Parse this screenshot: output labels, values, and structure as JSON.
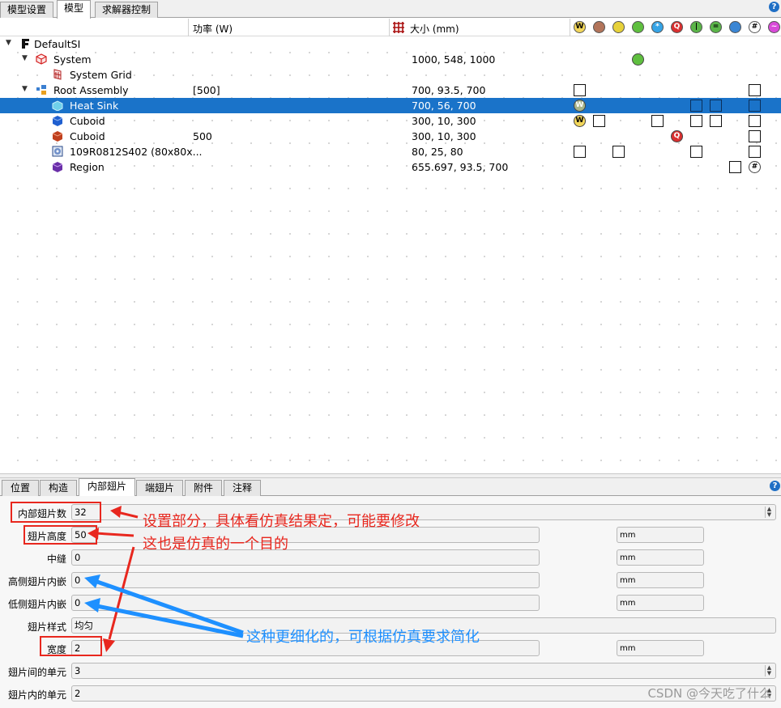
{
  "top_tabs": [
    {
      "label": "模型设置"
    },
    {
      "label": "模型",
      "active": true
    },
    {
      "label": "求解器控制"
    }
  ],
  "header": {
    "power_col": "功率 (W)",
    "size_col": "大小 (mm)"
  },
  "tree": [
    {
      "name": "DefaultSI",
      "power": "",
      "size": ""
    },
    {
      "name": "System",
      "power": "",
      "size": "1000, 548, 1000"
    },
    {
      "name": "System Grid",
      "power": "",
      "size": ""
    },
    {
      "name": "Root Assembly",
      "power": "[500]",
      "size": "700, 93.5, 700"
    },
    {
      "name": "Heat Sink",
      "power": "",
      "size": "700, 56, 700",
      "selected": true
    },
    {
      "name": "Cuboid",
      "power": "",
      "size": "300, 10, 300"
    },
    {
      "name": "Cuboid",
      "power": "500",
      "size": "300, 10, 300"
    },
    {
      "name": "109R0812S402 (80x80x...",
      "power": "",
      "size": "80, 25, 80"
    },
    {
      "name": "Region",
      "power": "",
      "size": "655.697, 93.5, 700"
    }
  ],
  "bottom_tabs": [
    {
      "label": "位置"
    },
    {
      "label": "构造"
    },
    {
      "label": "内部翅片",
      "active": true
    },
    {
      "label": "端翅片"
    },
    {
      "label": "附件"
    },
    {
      "label": "注释"
    }
  ],
  "props": {
    "fin_count": {
      "label": "内部翅片数",
      "value": "32"
    },
    "fin_height": {
      "label": "翅片高度",
      "value": "50",
      "unit": "mm"
    },
    "gap": {
      "label": "中缝",
      "value": "0",
      "unit": "mm"
    },
    "high_inset": {
      "label": "高侧翅片内嵌",
      "value": "0",
      "unit": "mm"
    },
    "low_inset": {
      "label": "低侧翅片内嵌",
      "value": "0",
      "unit": "mm"
    },
    "fin_style": {
      "label": "翅片样式",
      "value": "均匀"
    },
    "width": {
      "label": "宽度",
      "value": "2",
      "unit": "mm"
    },
    "cells_between": {
      "label": "翅片间的单元",
      "value": "3"
    },
    "cells_within": {
      "label": "翅片内的单元",
      "value": "2"
    }
  },
  "annotations": {
    "red1": "设置部分，具体看仿真结果定，可能要修改",
    "red2": "这也是仿真的一个目的",
    "blue": "这种更细化的，可根据仿真要求简化"
  },
  "watermark": "CSDN @今天吃了什么",
  "colors": {
    "selection": "#1a73c9",
    "annotation_red": "#e8271e",
    "annotation_blue": "#1e90ff"
  }
}
